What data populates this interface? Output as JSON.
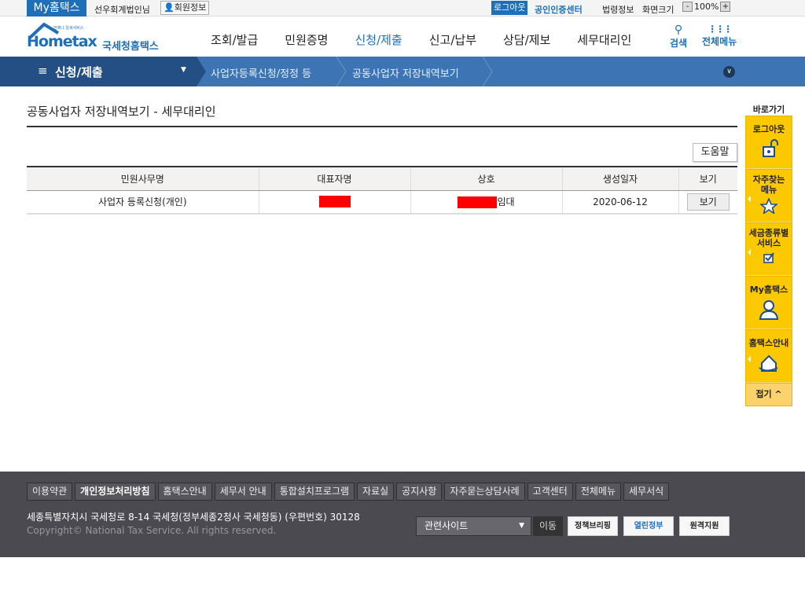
{
  "topbar": {
    "my_hometax": "My홈택스",
    "user": "선우회계법인님",
    "member_info": "회원정보",
    "logout": "로그아웃",
    "cert_center": "공인인증센터",
    "law_info": "법령정보",
    "screen_size": "화면크기",
    "zoom": "100%",
    "minus": "-",
    "plus": "+"
  },
  "header": {
    "logo_main": "Hometax",
    "logo_sub": "국세청홈택스",
    "logo_tag": "언제나 일세서비스",
    "nav": [
      "조회/발급",
      "민원증명",
      "신청/제출",
      "신고/납부",
      "상담/제보",
      "세무대리인"
    ],
    "search": "검색",
    "all_menu": "전체메뉴"
  },
  "breadcrumb": {
    "section": "신청/제출",
    "level1": "사업자등록신청/정정 등",
    "level2": "공동사업자 저장내역보기"
  },
  "page": {
    "title": "공동사업자 저장내역보기 - 세무대리인",
    "help": "도움말"
  },
  "table": {
    "headers": [
      "민원사무명",
      "대표자명",
      "상호",
      "생성일자",
      "보기"
    ],
    "rows": [
      {
        "service": "사업자 등록신청(개인)",
        "representative": "",
        "company_suffix": "임대",
        "date": "2020-06-12",
        "view": "보기"
      }
    ]
  },
  "quick": {
    "title": "바로가기",
    "items": [
      "로그아웃",
      "자주찾는 메뉴",
      "세금종류별 서비스",
      "My홈택스",
      "홈택스안내"
    ],
    "fold": "접기 ^"
  },
  "footer": {
    "links": [
      "이용약관",
      "개인정보처리방침",
      "홈택스안내",
      "세무서 안내",
      "통합설치프로그램",
      "자료실",
      "공지사항",
      "자주묻는상담사례",
      "고객센터",
      "전체메뉴",
      "세무서식"
    ],
    "address": "세종특별자치시 국세청로 8-14 국세청(정부세종2청사 국세청동) (우편번호) 30128",
    "copyright": "Copyright© National Tax Service. All rights reserved.",
    "related_sites": "관련사이트",
    "go": "이동",
    "policy": "정책브리핑",
    "gov": "열린정부",
    "remote": "원격지원"
  },
  "colors": {
    "brand": "#1e6fb8",
    "bar": "#3d74b4",
    "quick": "#fcc800",
    "footer": "#4a4a50"
  }
}
